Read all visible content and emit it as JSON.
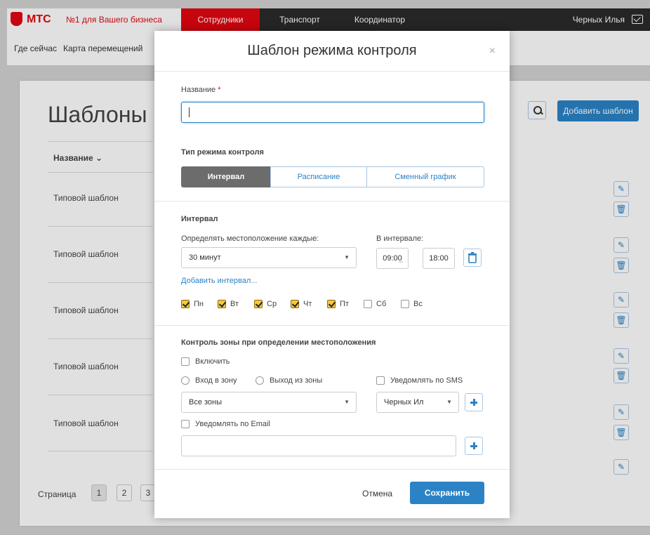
{
  "header": {
    "brand": "МТС",
    "slogan": "№1 для Вашего бизнеса",
    "nav": [
      "Сотрудники",
      "Транспорт",
      "Координатор"
    ],
    "user": "Черных Илья"
  },
  "subnav": [
    "Где сейчас",
    "Карта перемещений"
  ],
  "page": {
    "title": "Шаблоны р",
    "add_button": "Добавить шаблон",
    "column_name": "Название ⌄",
    "rows": [
      "Типовой шаблон",
      "Типовой шаблон",
      "Типовой шаблон",
      "Типовой шаблон",
      "Типовой шаблон"
    ],
    "pager_label": "Страница",
    "pages": [
      "1",
      "2",
      "3"
    ]
  },
  "modal": {
    "title": "Шаблон режима контроля",
    "close": "×",
    "name_label": "Название",
    "name_required": "*",
    "name_value": "",
    "mode_label": "Тип режима контроля",
    "modes": [
      "Интервал",
      "Расписание",
      "Сменный график"
    ],
    "interval_section": "Интервал",
    "every_label": "Определять местоположение каждые:",
    "every_value": "30 минут",
    "range_label": "В интервале:",
    "time_from": "09:00",
    "time_to": "18:00",
    "time_sep": "–",
    "add_interval": "Добавить интервал...",
    "days": [
      {
        "label": "Пн",
        "checked": true
      },
      {
        "label": "Вт",
        "checked": true
      },
      {
        "label": "Ср",
        "checked": true
      },
      {
        "label": "Чт",
        "checked": true
      },
      {
        "label": "Пт",
        "checked": true
      },
      {
        "label": "Сб",
        "checked": false
      },
      {
        "label": "Вс",
        "checked": false
      }
    ],
    "zone_section": "Контроль зоны при определении местоположения",
    "enable_label": "Включить",
    "enter_zone": "Вход в зону",
    "exit_zone": "Выход из зоны",
    "notify_sms": "Уведомлять по SMS",
    "zones_value": "Все зоны",
    "sms_user": "Черных Ил",
    "notify_email": "Уведомлять по Email",
    "email_value": "",
    "cancel": "Отмена",
    "save": "Сохранить"
  }
}
